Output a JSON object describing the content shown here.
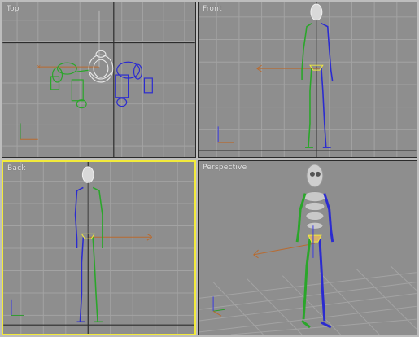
{
  "viewports": {
    "top": {
      "label": "Top"
    },
    "front": {
      "label": "Front"
    },
    "back": {
      "label": "Back"
    },
    "perspective": {
      "label": "Perspective"
    }
  },
  "active_viewport": "back",
  "colors": {
    "viewport_bg": "#8e8e8e",
    "grid": "#a3a3a3",
    "grid_axis": "#2c2c2c",
    "active_border": "#f2ea3b",
    "left_limb": "#2aa62a",
    "right_limb": "#2b2bd0",
    "spine": "#5a5a5a",
    "head": "#d9d9d9",
    "axis_x": "#b96a2e",
    "axis_y": "#2b9a2b",
    "axis_z": "#3a3ae0"
  }
}
